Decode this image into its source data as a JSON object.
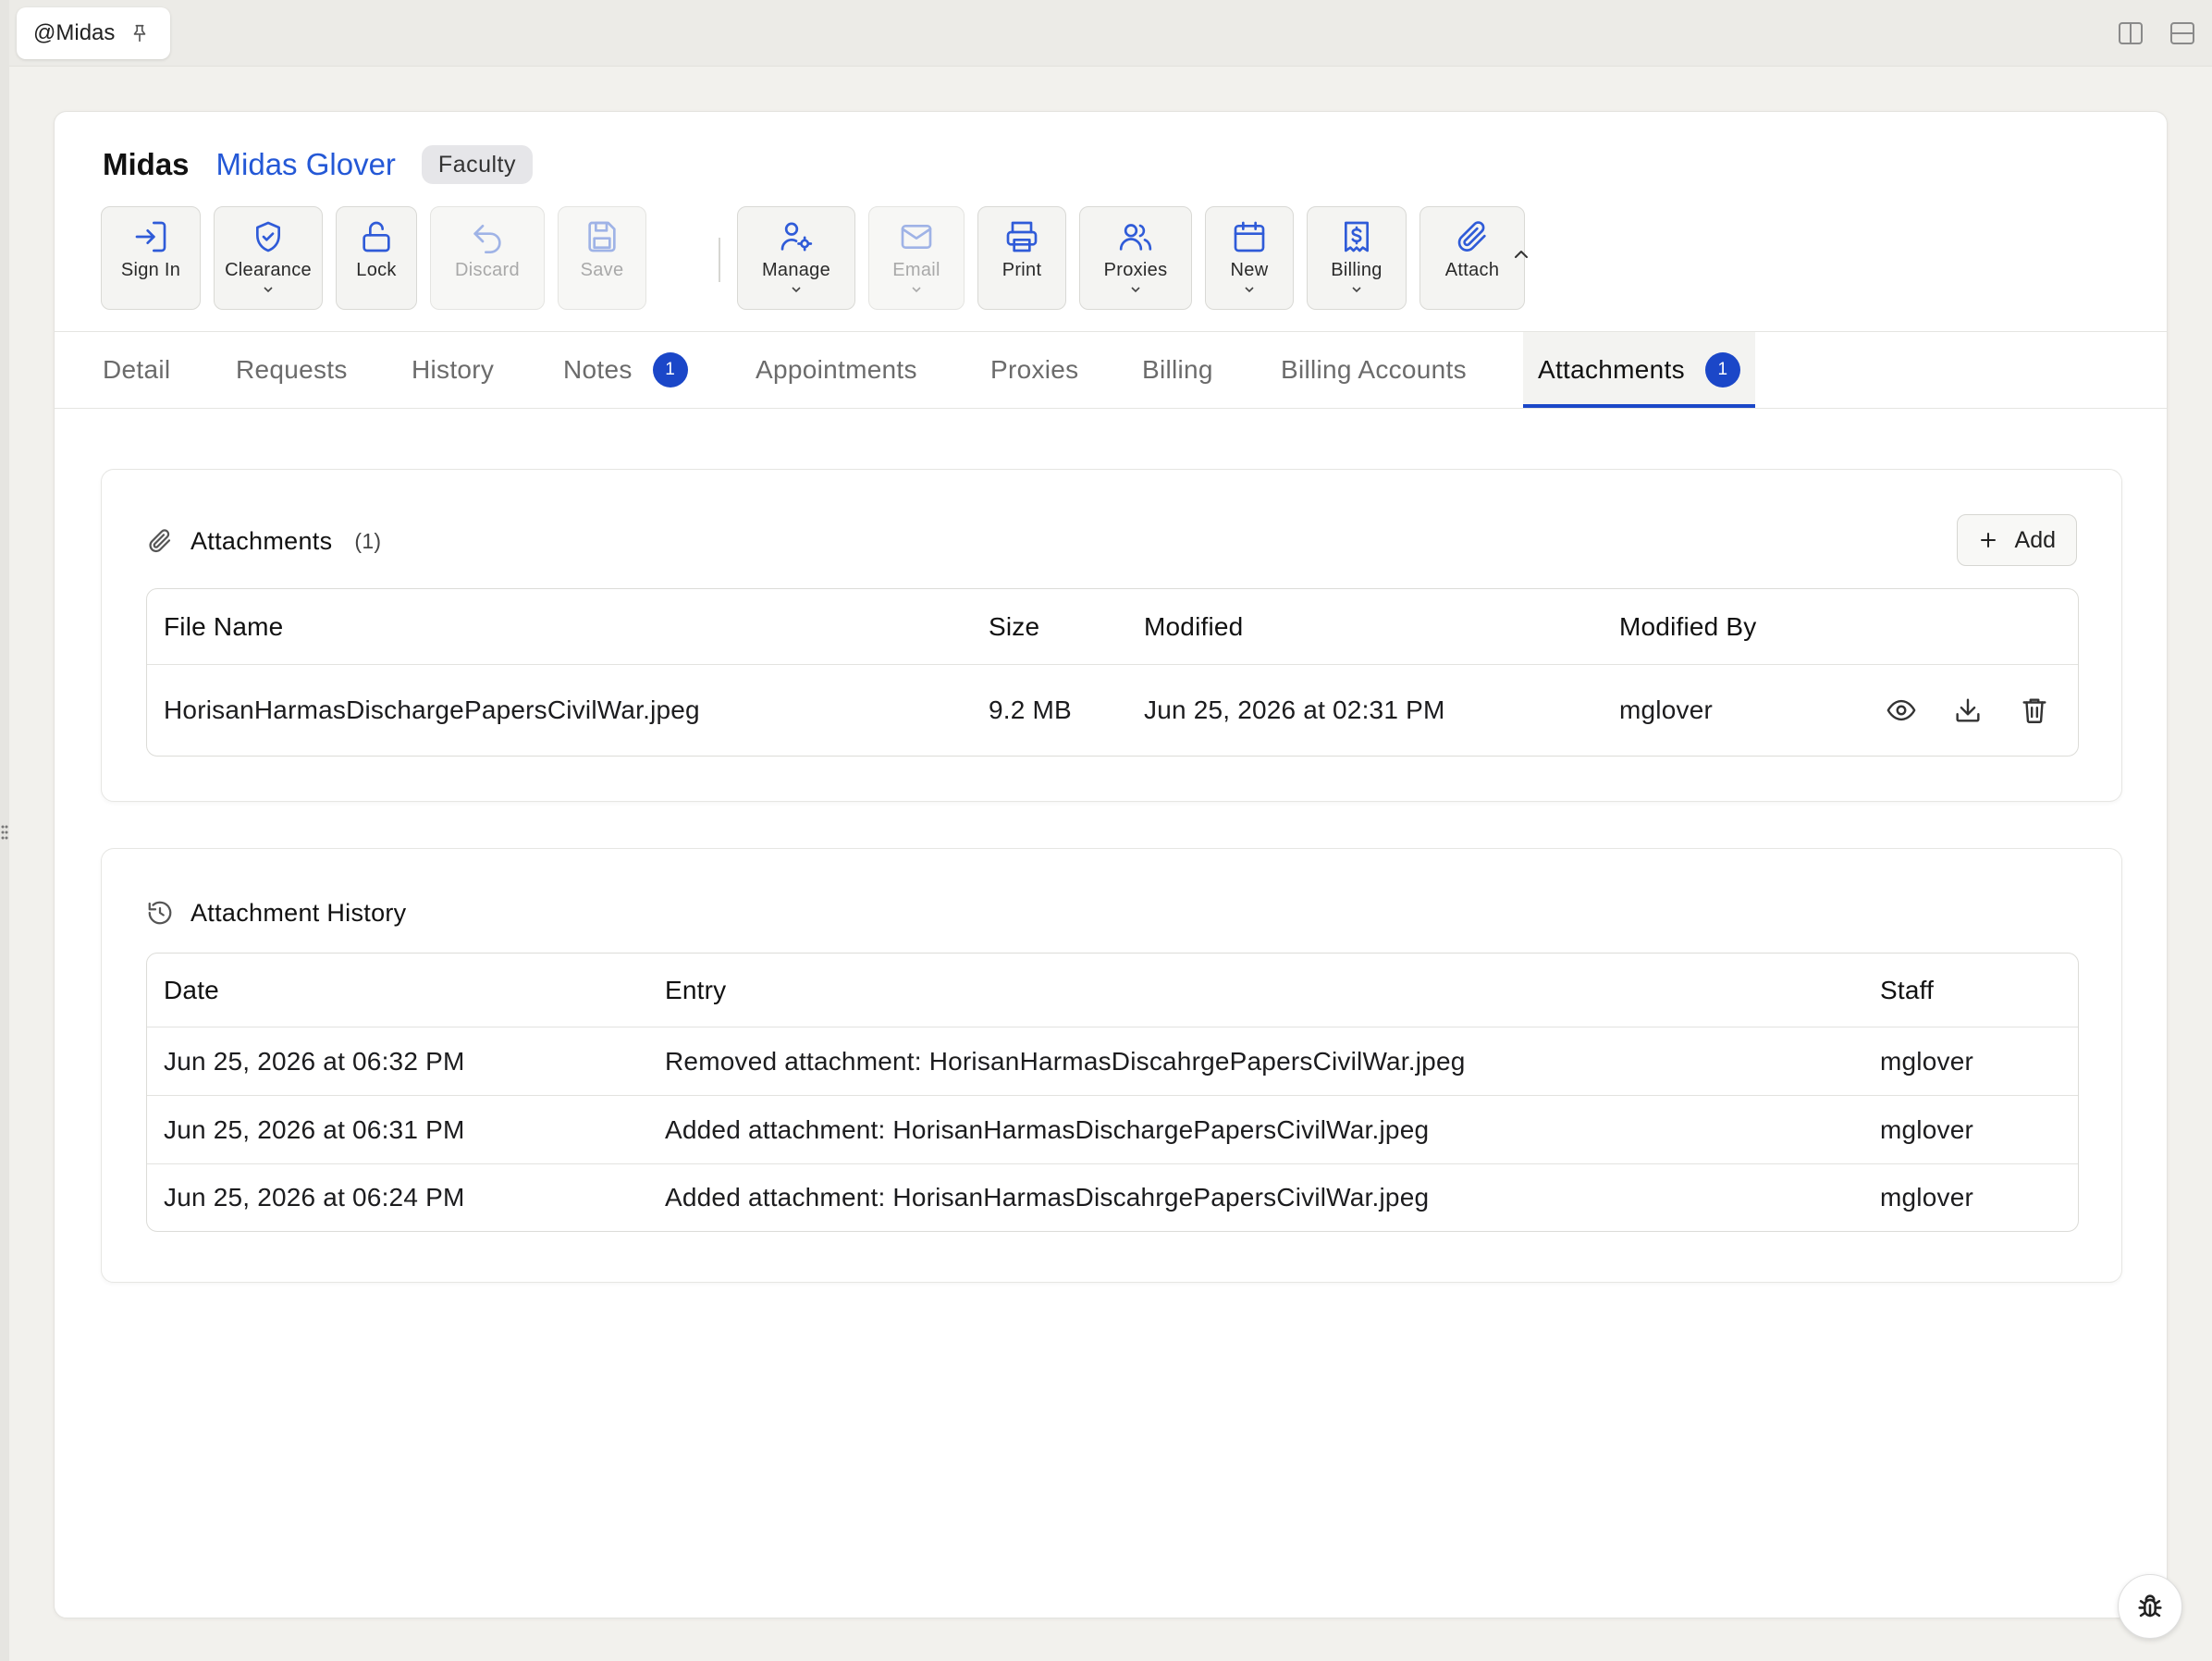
{
  "window_tab": {
    "label": "@Midas",
    "pin_icon": "pin-icon"
  },
  "window_controls": [
    "split-vertical-icon",
    "split-horizontal-icon"
  ],
  "header": {
    "username": "Midas",
    "full_name": "Midas Glover",
    "role_badge": "Faculty"
  },
  "toolbar": {
    "buttons": [
      {
        "label": "Sign In",
        "icon": "sign-in-icon",
        "dropdown": false,
        "disabled": false
      },
      {
        "label": "Clearance",
        "icon": "shield-check-icon",
        "dropdown": true,
        "disabled": false
      },
      {
        "label": "Lock",
        "icon": "unlock-icon",
        "dropdown": false,
        "disabled": false
      },
      {
        "label": "Discard",
        "icon": "undo-icon",
        "dropdown": false,
        "disabled": true
      },
      {
        "label": "Save",
        "icon": "save-icon",
        "dropdown": false,
        "disabled": true
      },
      {
        "label": "Manage",
        "icon": "user-cog-icon",
        "dropdown": true,
        "disabled": false
      },
      {
        "label": "Email",
        "icon": "mail-icon",
        "dropdown": true,
        "disabled": true
      },
      {
        "label": "Print",
        "icon": "printer-icon",
        "dropdown": false,
        "disabled": false
      },
      {
        "label": "Proxies",
        "icon": "users-icon",
        "dropdown": true,
        "disabled": false
      },
      {
        "label": "New",
        "icon": "calendar-icon",
        "dropdown": true,
        "disabled": false
      },
      {
        "label": "Billing",
        "icon": "receipt-dollar-icon",
        "dropdown": true,
        "disabled": false
      },
      {
        "label": "Attach",
        "icon": "paperclip-icon",
        "dropdown": false,
        "disabled": false
      }
    ]
  },
  "tabs": [
    {
      "label": "Detail"
    },
    {
      "label": "Requests"
    },
    {
      "label": "History"
    },
    {
      "label": "Notes",
      "count": "1"
    },
    {
      "label": "Appointments"
    },
    {
      "label": "Proxies"
    },
    {
      "label": "Billing"
    },
    {
      "label": "Billing Accounts"
    },
    {
      "label": "Attachments",
      "count": "1",
      "active": true
    }
  ],
  "attachments": {
    "title": "Attachments",
    "count": "(1)",
    "add_label": "Add",
    "columns": [
      "File Name",
      "Size",
      "Modified",
      "Modified By"
    ],
    "rows": [
      {
        "file_name": "HorisanHarmasDischargePapersCivilWar.jpeg",
        "size": "9.2 MB",
        "modified": "Jun 25, 2026 at 02:31 PM",
        "modified_by": "mglover"
      }
    ]
  },
  "history": {
    "title": "Attachment History",
    "columns": [
      "Date",
      "Entry",
      "Staff"
    ],
    "rows": [
      {
        "date": "Jun 25, 2026 at 06:32 PM",
        "entry": "Removed attachment: HorisanHarmasDiscahrgePapersCivilWar.jpeg",
        "staff": "mglover"
      },
      {
        "date": "Jun 25, 2026 at 06:31 PM",
        "entry": "Added attachment: HorisanHarmasDischargePapersCivilWar.jpeg",
        "staff": "mglover"
      },
      {
        "date": "Jun 25, 2026 at 06:24 PM",
        "entry": "Added attachment: HorisanHarmasDiscahrgePapersCivilWar.jpeg",
        "staff": "mglover"
      }
    ]
  },
  "colors": {
    "accent": "#1b47c8",
    "link": "#2458d6",
    "icon": "#2f5bd8",
    "disabled_icon": "#9fb3e6"
  }
}
